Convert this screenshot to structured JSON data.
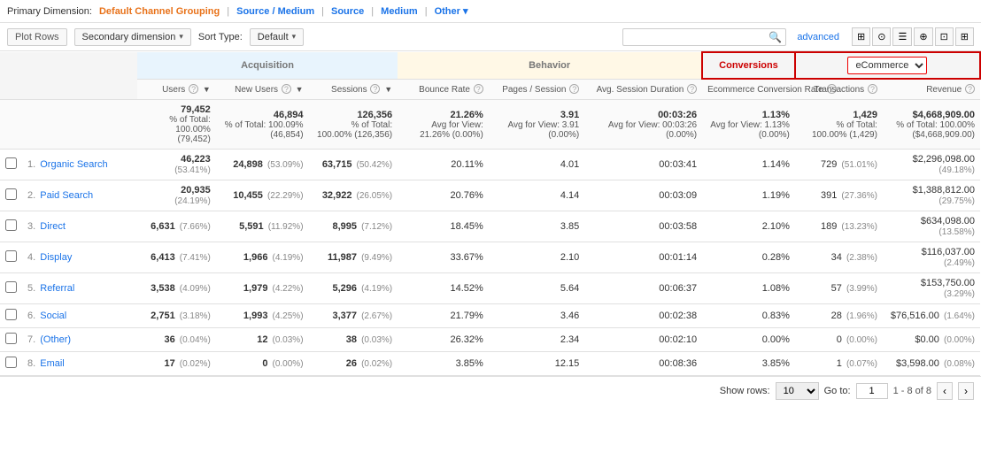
{
  "primaryDimension": {
    "label": "Primary Dimension:",
    "options": [
      "Default Channel Grouping",
      "Source / Medium",
      "Source",
      "Medium",
      "Other"
    ]
  },
  "toolbar": {
    "plotRows": "Plot Rows",
    "secondaryDimension": "Secondary dimension",
    "sortType": "Sort Type:",
    "sortDefault": "Default",
    "searchPlaceholder": "",
    "advanced": "advanced"
  },
  "viewIcons": [
    "⊞",
    "⊙",
    "☰",
    "⊕",
    "⊡",
    "⊞⊞"
  ],
  "table": {
    "dimensionLabel": "Default Channel Grouping",
    "groups": {
      "acquisition": "Acquisition",
      "behavior": "Behavior",
      "conversions": "Conversions",
      "ecommerce": "eCommerce"
    },
    "columns": {
      "users": "Users",
      "newUsers": "New Users",
      "sessions": "Sessions",
      "bounceRate": "Bounce Rate",
      "pagesSession": "Pages / Session",
      "avgSession": "Avg. Session Duration",
      "ecommerceRate": "Ecommerce Conversion Rate",
      "transactions": "Transactions",
      "revenue": "Revenue"
    },
    "totals": {
      "users": "79,452",
      "usersOfTotal": "% of Total: 100.00% (79,452)",
      "newUsers": "46,894",
      "newUsersOfTotal": "% of Total: 100.09% (46,854)",
      "sessions": "126,356",
      "sessionsOfTotal": "% of Total: 100.00% (126,356)",
      "bounceRate": "21.26%",
      "bounceRateAvg": "Avg for View: 21.26% (0.00%)",
      "pagesSession": "3.91",
      "pagesSessionAvg": "Avg for View: 3.91 (0.00%)",
      "avgSession": "00:03:26",
      "avgSessionAvg": "Avg for View: 00:03:26 (0.00%)",
      "ecommerceRate": "1.13%",
      "ecommerceRateAvg": "Avg for View: 1.13% (0.00%)",
      "transactions": "1,429",
      "transactionsOfTotal": "% of Total: 100.00% (1,429)",
      "revenue": "$4,668,909.00",
      "revenueOfTotal": "% of Total: 100.00% ($4,668,909.00)"
    },
    "rows": [
      {
        "num": "1.",
        "channel": "Organic Search",
        "users": "46,223",
        "usersPct": "(53.41%)",
        "newUsers": "24,898",
        "newUsersPct": "(53.09%)",
        "sessions": "63,715",
        "sessionsPct": "(50.42%)",
        "bounceRate": "20.11%",
        "pagesSession": "4.01",
        "avgSession": "00:03:41",
        "ecommerceRate": "1.14%",
        "transactions": "729",
        "transactionsPct": "(51.01%)",
        "revenue": "$2,296,098.00",
        "revenuePct": "(49.18%)"
      },
      {
        "num": "2.",
        "channel": "Paid Search",
        "users": "20,935",
        "usersPct": "(24.19%)",
        "newUsers": "10,455",
        "newUsersPct": "(22.29%)",
        "sessions": "32,922",
        "sessionsPct": "(26.05%)",
        "bounceRate": "20.76%",
        "pagesSession": "4.14",
        "avgSession": "00:03:09",
        "ecommerceRate": "1.19%",
        "transactions": "391",
        "transactionsPct": "(27.36%)",
        "revenue": "$1,388,812.00",
        "revenuePct": "(29.75%)"
      },
      {
        "num": "3.",
        "channel": "Direct",
        "users": "6,631",
        "usersPct": "(7.66%)",
        "newUsers": "5,591",
        "newUsersPct": "(11.92%)",
        "sessions": "8,995",
        "sessionsPct": "(7.12%)",
        "bounceRate": "18.45%",
        "pagesSession": "3.85",
        "avgSession": "00:03:58",
        "ecommerceRate": "2.10%",
        "transactions": "189",
        "transactionsPct": "(13.23%)",
        "revenue": "$634,098.00",
        "revenuePct": "(13.58%)"
      },
      {
        "num": "4.",
        "channel": "Display",
        "users": "6,413",
        "usersPct": "(7.41%)",
        "newUsers": "1,966",
        "newUsersPct": "(4.19%)",
        "sessions": "11,987",
        "sessionsPct": "(9.49%)",
        "bounceRate": "33.67%",
        "pagesSession": "2.10",
        "avgSession": "00:01:14",
        "ecommerceRate": "0.28%",
        "transactions": "34",
        "transactionsPct": "(2.38%)",
        "revenue": "$116,037.00",
        "revenuePct": "(2.49%)"
      },
      {
        "num": "5.",
        "channel": "Referral",
        "users": "3,538",
        "usersPct": "(4.09%)",
        "newUsers": "1,979",
        "newUsersPct": "(4.22%)",
        "sessions": "5,296",
        "sessionsPct": "(4.19%)",
        "bounceRate": "14.52%",
        "pagesSession": "5.64",
        "avgSession": "00:06:37",
        "ecommerceRate": "1.08%",
        "transactions": "57",
        "transactionsPct": "(3.99%)",
        "revenue": "$153,750.00",
        "revenuePct": "(3.29%)"
      },
      {
        "num": "6.",
        "channel": "Social",
        "users": "2,751",
        "usersPct": "(3.18%)",
        "newUsers": "1,993",
        "newUsersPct": "(4.25%)",
        "sessions": "3,377",
        "sessionsPct": "(2.67%)",
        "bounceRate": "21.79%",
        "pagesSession": "3.46",
        "avgSession": "00:02:38",
        "ecommerceRate": "0.83%",
        "transactions": "28",
        "transactionsPct": "(1.96%)",
        "revenue": "$76,516.00",
        "revenuePct": "(1.64%)"
      },
      {
        "num": "7.",
        "channel": "(Other)",
        "users": "36",
        "usersPct": "(0.04%)",
        "newUsers": "12",
        "newUsersPct": "(0.03%)",
        "sessions": "38",
        "sessionsPct": "(0.03%)",
        "bounceRate": "26.32%",
        "pagesSession": "2.34",
        "avgSession": "00:02:10",
        "ecommerceRate": "0.00%",
        "transactions": "0",
        "transactionsPct": "(0.00%)",
        "revenue": "$0.00",
        "revenuePct": "(0.00%)"
      },
      {
        "num": "8.",
        "channel": "Email",
        "users": "17",
        "usersPct": "(0.02%)",
        "newUsers": "0",
        "newUsersPct": "(0.00%)",
        "sessions": "26",
        "sessionsPct": "(0.02%)",
        "bounceRate": "3.85%",
        "pagesSession": "12.15",
        "avgSession": "00:08:36",
        "ecommerceRate": "3.85%",
        "transactions": "1",
        "transactionsPct": "(0.07%)",
        "revenue": "$3,598.00",
        "revenuePct": "(0.08%)"
      }
    ]
  },
  "footer": {
    "showRowsLabel": "Show rows:",
    "showRowsValue": "10",
    "goToLabel": "Go to:",
    "goToValue": "1",
    "pageRange": "1 - 8 of 8"
  }
}
